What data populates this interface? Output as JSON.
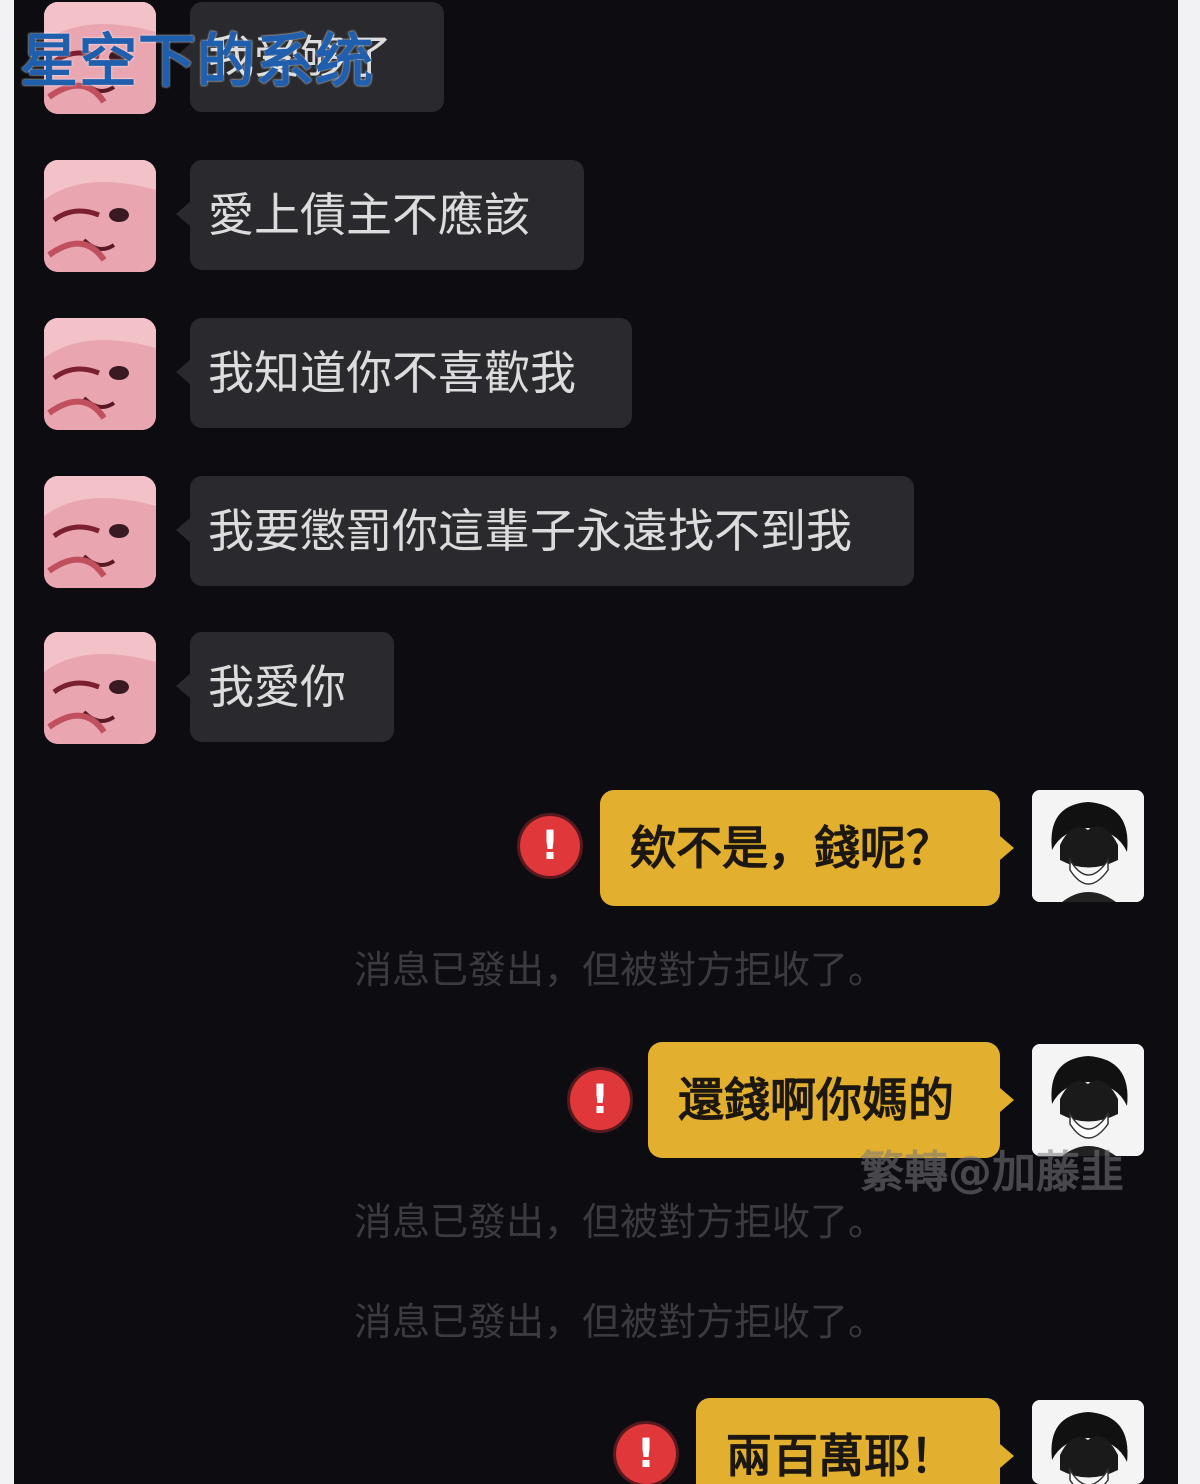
{
  "watermarks": {
    "top": "星空下的系统",
    "mid": "繁轉@加藤韭"
  },
  "incoming": {
    "messages": [
      {
        "text": "我受够了"
      },
      {
        "text": "愛上債主不應該"
      },
      {
        "text": "我知道你不喜歡我"
      },
      {
        "text": "我要懲罰你這輩子永遠找不到我"
      },
      {
        "text": "我愛你"
      }
    ]
  },
  "outgoing": {
    "messages": [
      {
        "text": "欸不是，錢呢？",
        "status": "!"
      },
      {
        "text": "還錢啊你媽的",
        "status": "!"
      },
      {
        "text": "兩百萬耶！",
        "status": "!"
      }
    ]
  },
  "system": {
    "rejected_note_1": "消息已發出，但被對方拒收了。",
    "rejected_note_2": "消息已發出，但被對方拒收了。",
    "rejected_note_3": "消息已發出，但被對方拒收了。"
  },
  "colors": {
    "incoming_bubble": "#2a2a2e",
    "outgoing_bubble": "#e2b02e",
    "error_icon": "#e0373a",
    "background": "#0d0c10"
  },
  "icons": {
    "incoming_avatar": "anime-girl-avatar",
    "outgoing_avatar": "anime-boy-avatar",
    "send_failed": "error-exclamation-icon"
  }
}
